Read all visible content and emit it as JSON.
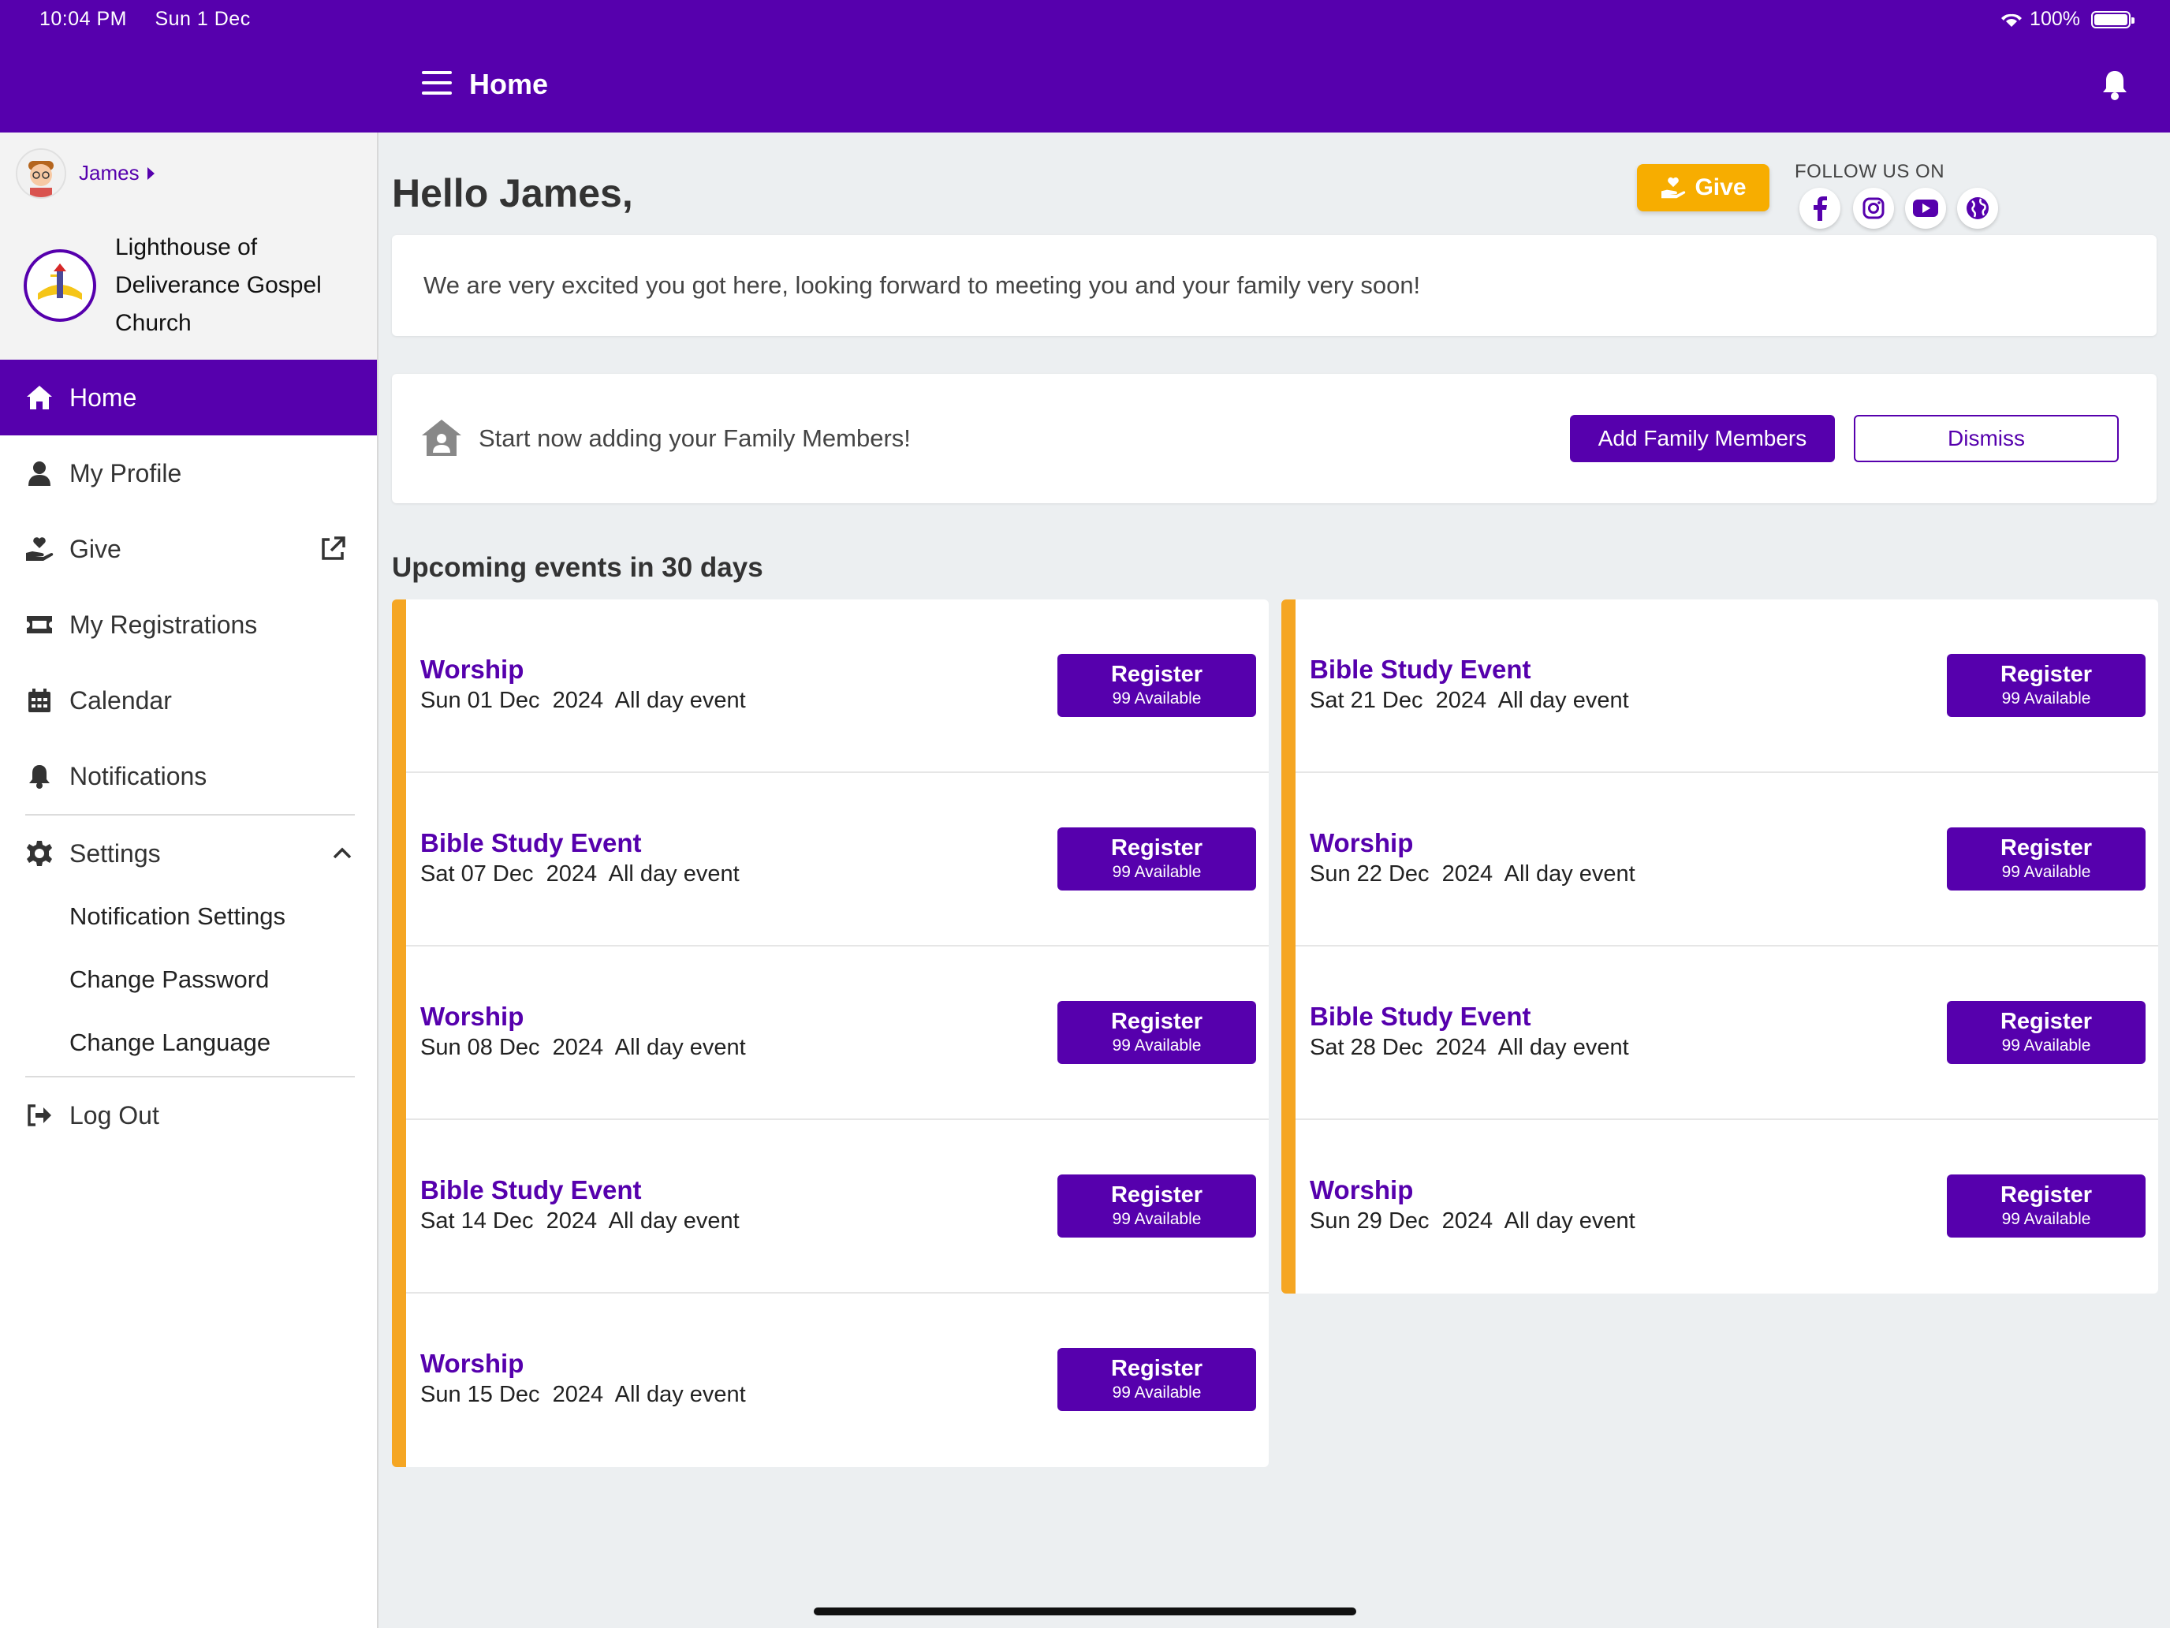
{
  "status_bar": {
    "time": "10:04 PM",
    "date": "Sun 1 Dec",
    "battery": "100%"
  },
  "header": {
    "title": "Home"
  },
  "sidebar": {
    "user_name": "James",
    "church_name_lines": [
      "Lighthouse of",
      "Deliverance Gospel",
      "Church"
    ],
    "items": [
      {
        "label": "Home",
        "icon": "home-icon"
      },
      {
        "label": "My Profile",
        "icon": "person-icon"
      },
      {
        "label": "Give",
        "icon": "hand-heart-icon"
      },
      {
        "label": "My Registrations",
        "icon": "ticket-icon"
      },
      {
        "label": "Calendar",
        "icon": "calendar-icon"
      },
      {
        "label": "Notifications",
        "icon": "bell-icon"
      },
      {
        "label": "Settings",
        "icon": "gear-icon"
      }
    ],
    "settings_subitems": [
      "Notification Settings",
      "Change Password",
      "Change Language"
    ],
    "logout_label": "Log Out"
  },
  "main": {
    "greeting": "Hello James,",
    "give_label": "Give",
    "follow_label": "FOLLOW US ON",
    "social_icons": [
      "facebook-icon",
      "instagram-icon",
      "youtube-icon",
      "globe-icon"
    ],
    "welcome_message": "We are very excited you got here, looking forward to meeting you and your family very soon!",
    "family_prompt": "Start now adding your Family Members!",
    "add_family_label": "Add Family Members",
    "dismiss_label": "Dismiss",
    "events_title": "Upcoming events in 30 days",
    "register_label": "Register",
    "available_label": "99 Available",
    "events_left": [
      {
        "title": "Worship",
        "date": "Sun 01 Dec  2024  All day event"
      },
      {
        "title": "Bible Study Event",
        "date": "Sat 07 Dec  2024  All day event"
      },
      {
        "title": "Worship",
        "date": "Sun 08 Dec  2024  All day event"
      },
      {
        "title": "Bible Study Event",
        "date": "Sat 14 Dec  2024  All day event"
      },
      {
        "title": "Worship",
        "date": "Sun 15 Dec  2024  All day event"
      }
    ],
    "events_right": [
      {
        "title": "Bible Study Event",
        "date": "Sat 21 Dec  2024  All day event"
      },
      {
        "title": "Worship",
        "date": "Sun 22 Dec  2024  All day event"
      },
      {
        "title": "Bible Study Event",
        "date": "Sat 28 Dec  2024  All day event"
      },
      {
        "title": "Worship",
        "date": "Sun 29 Dec  2024  All day event"
      }
    ]
  },
  "colors": {
    "primary": "#5600ad",
    "accent": "#f5a623",
    "give": "#f7ad00"
  }
}
